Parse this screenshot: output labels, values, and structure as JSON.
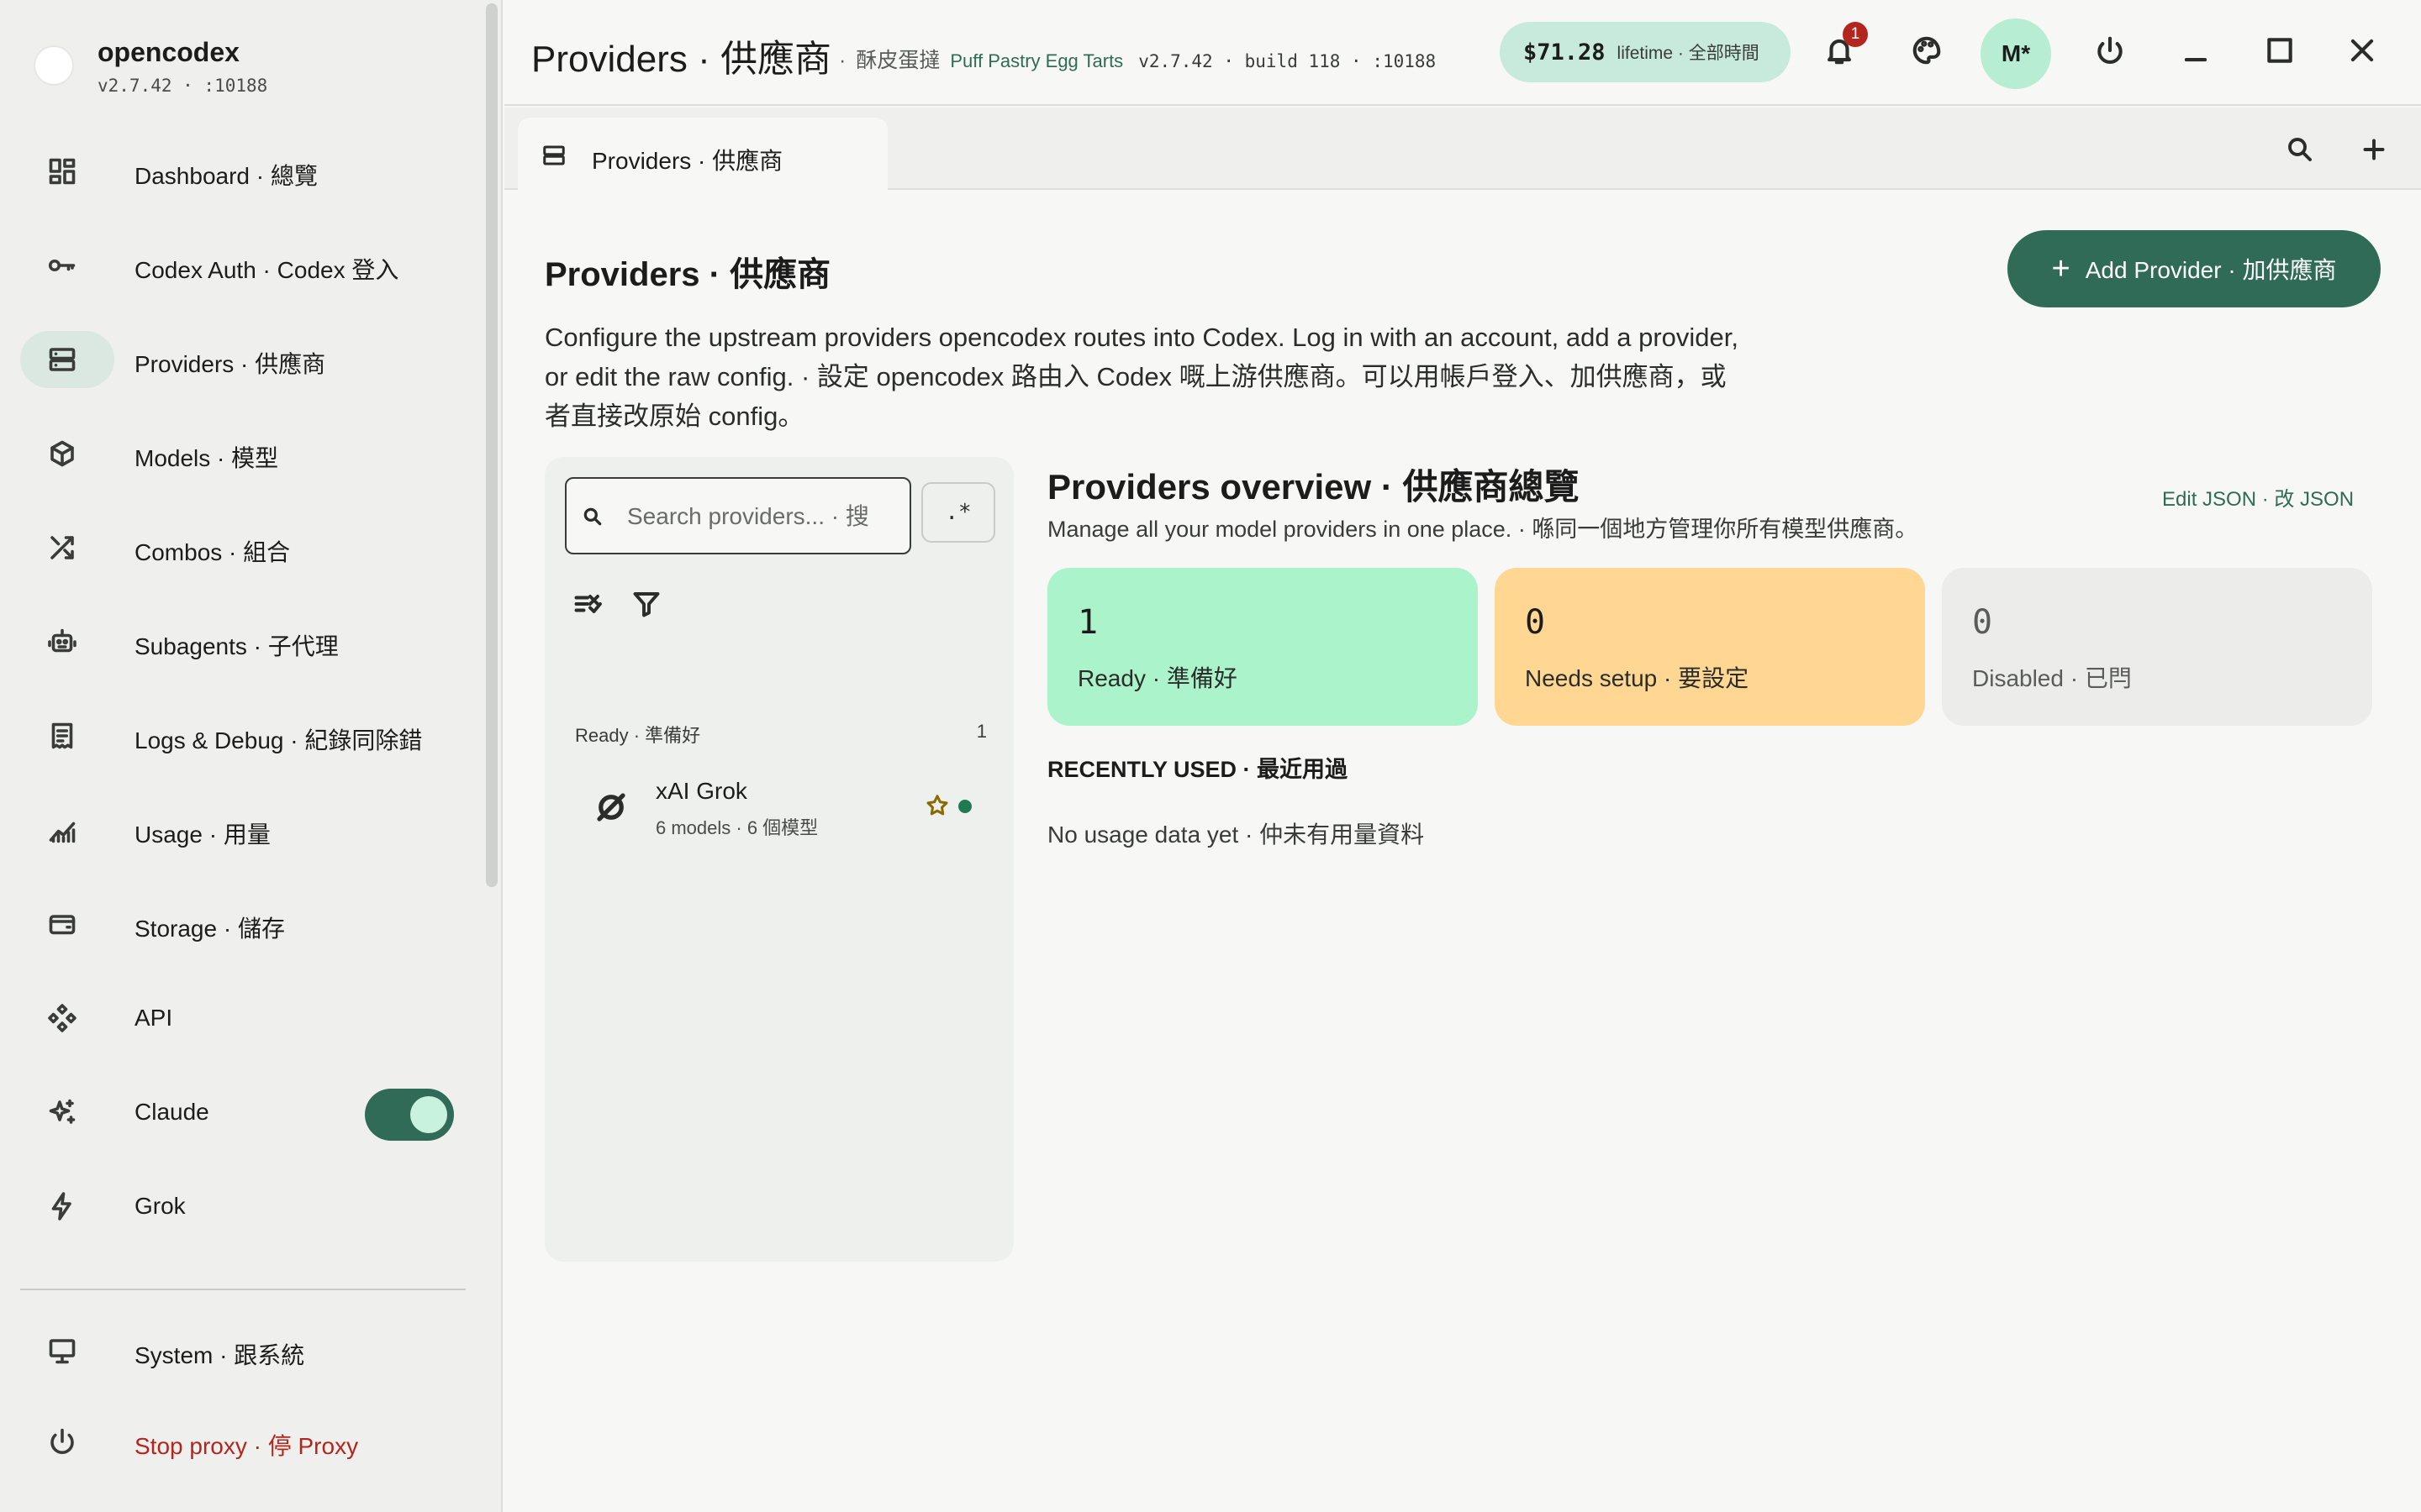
{
  "brand": {
    "name": "opencodex",
    "version": "v2.7.42 · :10188"
  },
  "sidebar": {
    "items": [
      {
        "label": "Dashboard · 總覽",
        "icon": "dashboard-icon"
      },
      {
        "label": "Codex Auth · Codex 登入",
        "icon": "key-icon"
      },
      {
        "label": "Providers · 供應商",
        "icon": "server-icon",
        "active": true
      },
      {
        "label": "Models · 模型",
        "icon": "cube-icon"
      },
      {
        "label": "Combos · 組合",
        "icon": "shuffle-icon"
      },
      {
        "label": "Subagents · 子代理",
        "icon": "robot-icon"
      },
      {
        "label": "Logs & Debug · 紀錄同除錯",
        "icon": "receipt-icon"
      },
      {
        "label": "Usage · 用量",
        "icon": "chart-icon"
      },
      {
        "label": "Storage · 儲存",
        "icon": "wallet-icon"
      },
      {
        "label": "API",
        "icon": "api-icon"
      },
      {
        "label": "Claude",
        "icon": "sparkle-icon",
        "toggle": true
      },
      {
        "label": "Grok",
        "icon": "bolt-icon"
      }
    ],
    "system_label": "System · 跟系統",
    "stop_label": "Stop proxy · 停 Proxy"
  },
  "topbar": {
    "title": "Providers · 供應商",
    "meta_sep": "·",
    "tart_zh": "酥皮蛋撻",
    "tart_en": "Puff Pastry Egg Tarts",
    "build": "v2.7.42 · build 118 · :10188",
    "cost_value": "$71.28",
    "cost_label": "lifetime · 全部時間",
    "notif_count": "1",
    "avatar_initials": "M*"
  },
  "tabs": [
    {
      "label": "Providers · 供應商"
    }
  ],
  "page": {
    "title": "Providers · 供應商",
    "add_button": "Add Provider · 加供應商",
    "description": "Configure the upstream providers opencodex routes into Codex. Log in with an account, add a provider, or edit the raw config. · 設定 opencodex 路由入 Codex 嘅上游供應商。可以用帳戶登入、加供應商，或者直接改原始 config。"
  },
  "list": {
    "search_placeholder": "Search providers... · 搜",
    "regex_label": ".*",
    "group_label": "Ready · 準備好",
    "group_count": "1",
    "providers": [
      {
        "name": "xAI Grok",
        "meta": "6 models · 6 個模型",
        "status_color": "#1f7a54"
      }
    ]
  },
  "overview": {
    "title": "Providers overview · 供應商總覽",
    "edit_json": "Edit JSON · 改 JSON",
    "subtitle": "Manage all your model providers in one place. · 喺同一個地方管理你所有模型供應商。",
    "stats": {
      "ready": {
        "value": "1",
        "label": "Ready · 準備好",
        "color": "#abf3ca"
      },
      "setup": {
        "value": "0",
        "label": "Needs setup · 要設定",
        "color": "#ffd793"
      },
      "disabled": {
        "value": "0",
        "label": "Disabled · 已閂",
        "color": "#ecedeb"
      }
    },
    "recent_heading": "RECENTLY USED · 最近用過",
    "recent_empty": "No usage data yet · 仲未有用量資料"
  },
  "colors": {
    "accent": "#2f6b57",
    "danger": "#b3261e"
  }
}
